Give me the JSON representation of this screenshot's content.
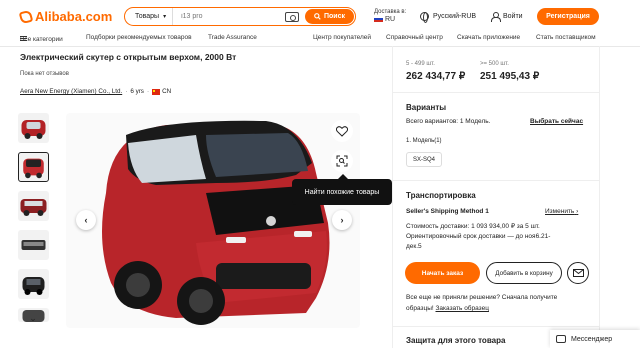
{
  "header": {
    "logo_text": "Alibaba.com",
    "search_category": "Товары",
    "search_placeholder": "i13 pro",
    "search_button": "Поиск",
    "ship_label": "Доставка в:",
    "ship_country": "RU",
    "language": "Русский-RUB",
    "login": "Войти",
    "register": "Регистрация"
  },
  "nav": {
    "items": [
      "Все категории",
      "Подборки рекомендуемых товаров",
      "Trade Assurance",
      "Центр покупателей",
      "Справочный центр",
      "Скачать приложение",
      "Стать поставщиком"
    ]
  },
  "product": {
    "title": "Электрический скутер с открытым верхом, 2000 Вт",
    "reviews": "Пока нет отзывов",
    "supplier_name": "Aera New Energy (Xiamen) Co., Ltd.",
    "supplier_years": "6 yrs",
    "supplier_country": "CN",
    "tooltip": "Найти похожие товары"
  },
  "pricing": {
    "tiers": [
      {
        "qty": "5 - 499 шт.",
        "price": "262 434,77 ₽"
      },
      {
        "qty": ">= 500 шт.",
        "price": "251 495,43 ₽"
      }
    ]
  },
  "variants": {
    "title": "Варианты",
    "total": "Всего вариантов: 1 Модель.",
    "select_link": "Выбрать сейчас",
    "model_label": "1. Модель(1)",
    "model_option": "SX-SQ4"
  },
  "shipping": {
    "title": "Транспортировка",
    "method": "Seller's Shipping Method 1",
    "change": "Изменить",
    "cost": "Стоимость доставки: 1 093 934,00 ₽ за 5 шт.",
    "eta_line1": "Ориентировочный срок доставки — до ноя6.21-",
    "eta_line2": "дек.5"
  },
  "actions": {
    "order": "Начать заказ",
    "cart": "Добавить в корзину",
    "undecided": "Все еще не приняли решение? Сначала получите",
    "sample_prefix": "образцы!",
    "sample_link": "Заказать образец"
  },
  "protection": {
    "title": "Защита для этого товара"
  },
  "messenger": {
    "label": "Мессенджер"
  },
  "colors": {
    "accent": "#ff6a00"
  }
}
